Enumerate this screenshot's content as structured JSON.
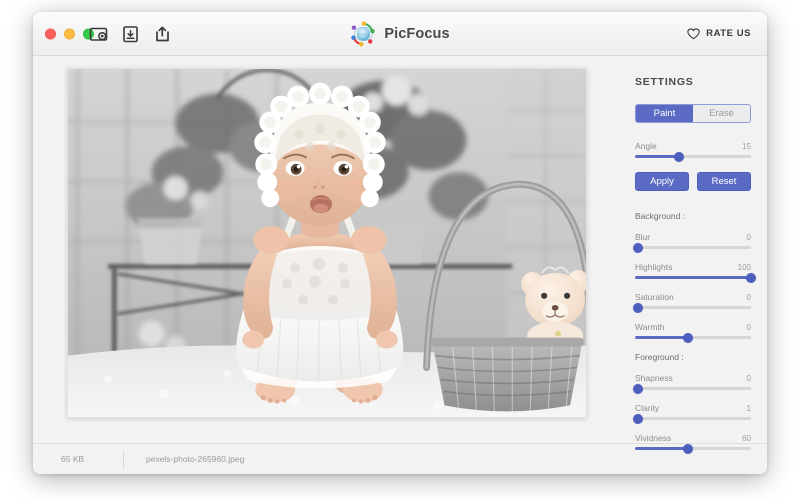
{
  "window": {
    "traffic_lights": [
      {
        "name": "close",
        "color": "#fc605c"
      },
      {
        "name": "minimize",
        "color": "#fdbc40"
      },
      {
        "name": "zoom",
        "color": "#34c749"
      }
    ]
  },
  "titlebar": {
    "app_name": "PicFocus",
    "tools": [
      {
        "name": "capture-region-icon"
      },
      {
        "name": "save-image-icon"
      },
      {
        "name": "share-icon"
      }
    ],
    "rate_us_label": "RATE US",
    "rate_us_icon": "heart-icon"
  },
  "settings": {
    "heading": "SETTINGS",
    "mode": {
      "paint_label": "Paint",
      "erase_label": "Erase",
      "selected": "Paint"
    },
    "angle": {
      "label": "Angle",
      "value": "15",
      "percent": 38
    },
    "buttons": {
      "apply_label": "Apply",
      "reset_label": "Reset"
    },
    "background": {
      "title": "Background :",
      "sliders": [
        {
          "label": "Blur",
          "value": "0",
          "percent": 3
        },
        {
          "label": "Highlights",
          "value": "100",
          "percent": 100
        },
        {
          "label": "Saturation",
          "value": "0",
          "percent": 3
        },
        {
          "label": "Warmth",
          "value": "0",
          "percent": 46
        }
      ]
    },
    "foreground": {
      "title": "Foreground :",
      "sliders": [
        {
          "label": "Shapness",
          "value": "0",
          "percent": 3
        },
        {
          "label": "Clarity",
          "value": "1",
          "percent": 3
        },
        {
          "label": "Vividness",
          "value": "60",
          "percent": 46
        }
      ]
    }
  },
  "statusbar": {
    "file_size": "65 KB",
    "file_name": "pexels-photo-265960.jpeg"
  },
  "photo": {
    "description": "Baby wearing a white lace bonnet and dress sitting on a white rug beside a wicker basket holding a teddy bear, desaturated background"
  },
  "colors": {
    "accent": "#5b6bc4",
    "accent_dark": "#4d5fbe",
    "panel_bg": "#f2f2f2",
    "track": "#d6d6d6"
  }
}
